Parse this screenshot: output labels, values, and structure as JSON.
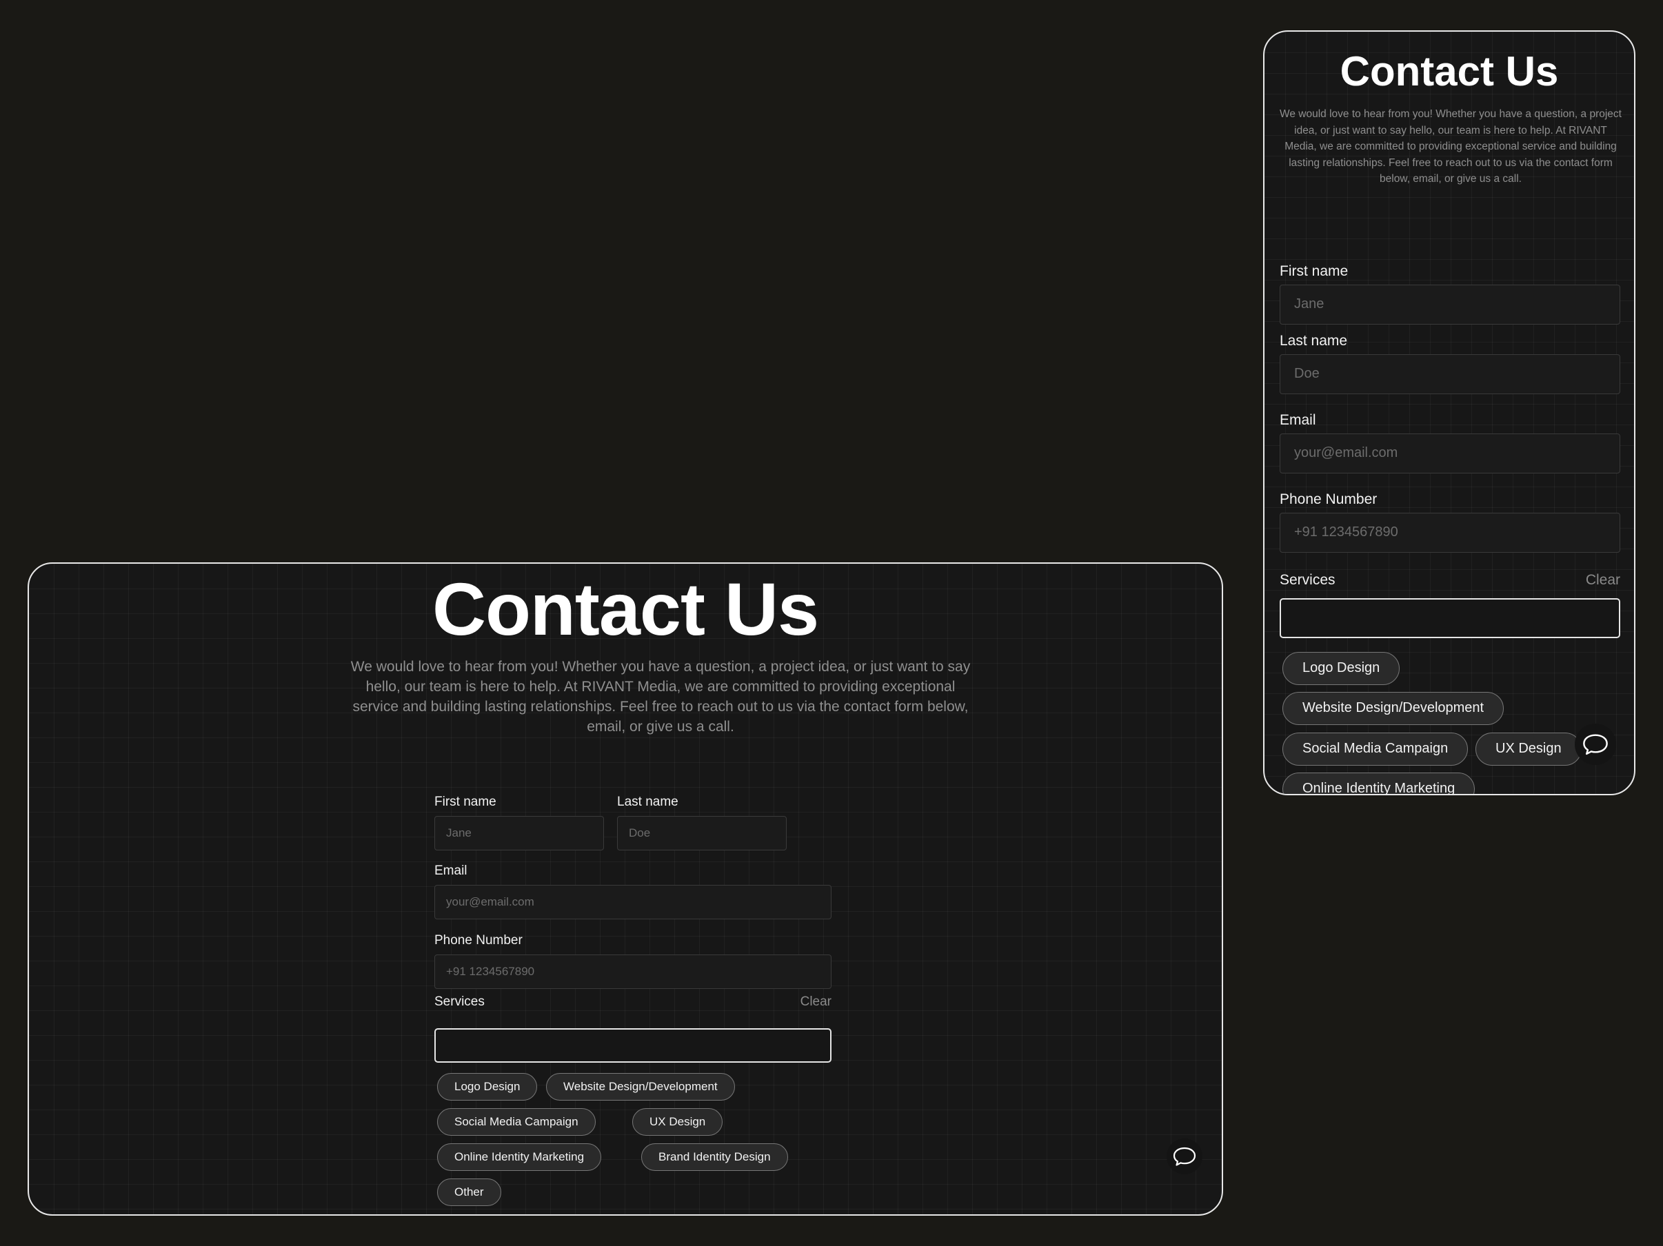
{
  "desktop": {
    "title": "Contact Us",
    "intro": "We would love to hear from you! Whether you have a question, a project idea, or just want to say hello, our team is here to help. At RIVANT Media, we are committed to providing exceptional service and building lasting relationships. Feel free to reach out to us via the contact form below, email, or give us a call.",
    "first_name": {
      "label": "First name",
      "placeholder": "Jane"
    },
    "last_name": {
      "label": "Last name",
      "placeholder": "Doe"
    },
    "email": {
      "label": "Email",
      "placeholder": "your@email.com"
    },
    "phone": {
      "label": "Phone Number",
      "placeholder": "+91 1234567890"
    },
    "services": {
      "label": "Services",
      "clear": "Clear",
      "chips": [
        "Logo Design",
        "Website Design/Development",
        "Social Media Campaign",
        "UX Design",
        "Online Identity Marketing",
        "Brand Identity Design",
        "Other"
      ]
    },
    "chat_icon": "chat-bubble-icon"
  },
  "mobile": {
    "title": "Contact Us",
    "intro": "We would love to hear from you! Whether you have a question, a project idea, or just want to say hello, our team is here to help. At RIVANT Media, we are committed to providing exceptional service and building lasting relationships. Feel free to reach out to us via the contact form below, email, or give us a call.",
    "first_name": {
      "label": "First name",
      "placeholder": "Jane"
    },
    "last_name": {
      "label": "Last name",
      "placeholder": "Doe"
    },
    "email": {
      "label": "Email",
      "placeholder": "your@email.com"
    },
    "phone": {
      "label": "Phone Number",
      "placeholder": "+91 1234567890"
    },
    "services": {
      "label": "Services",
      "clear": "Clear",
      "chips": [
        "Logo Design",
        "Website Design/Development",
        "Social Media Campaign",
        "UX Design",
        "Online Identity Marketing"
      ]
    },
    "chat_icon": "chat-bubble-icon"
  }
}
